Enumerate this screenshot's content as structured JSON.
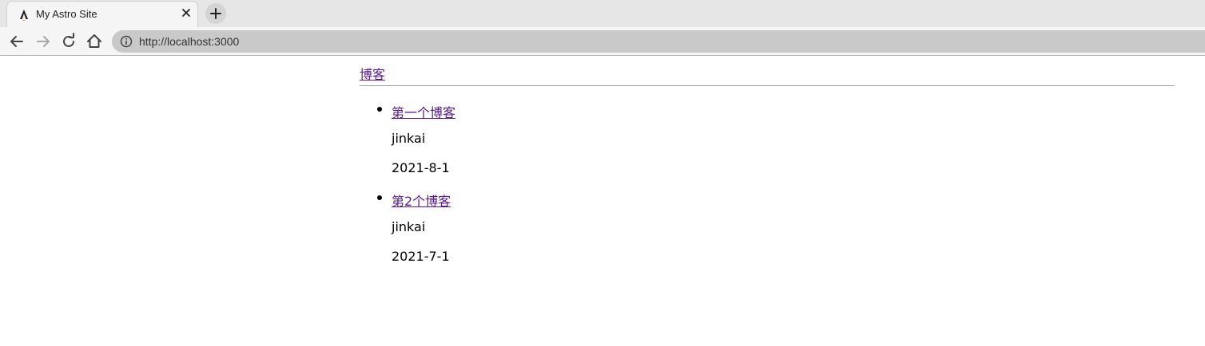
{
  "browser": {
    "tab_title": "My Astro Site",
    "favicon": "astro-logo-icon",
    "url": "http://localhost:3000"
  },
  "icons": {
    "back": "arrow-left-icon",
    "forward": "arrow-right-icon",
    "reload": "reload-icon",
    "home": "home-icon",
    "info": "info-icon",
    "close": "close-icon",
    "new_tab": "plus-icon"
  },
  "colors": {
    "visited_link": "#551a8b",
    "tab_active": "#f5f5f5",
    "omnibox": "#c9c9c9"
  },
  "page": {
    "header_link": "博客",
    "posts": [
      {
        "title": "第一个博客",
        "author": "jinkai",
        "date": "2021-8-1"
      },
      {
        "title": "第2个博客",
        "author": "jinkai",
        "date": "2021-7-1"
      }
    ]
  }
}
